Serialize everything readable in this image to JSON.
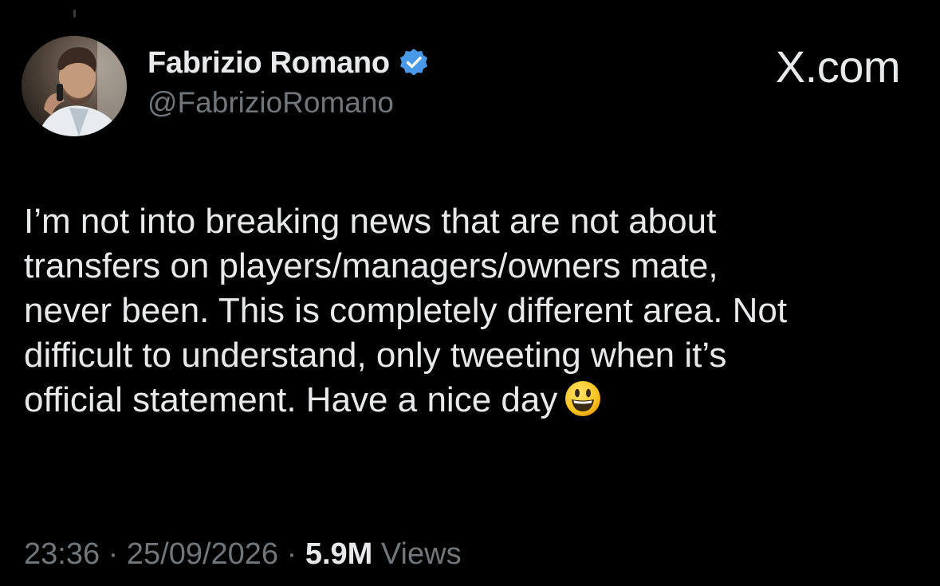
{
  "author": {
    "name": "Fabrizio Romano",
    "handle": "@FabrizioRomano",
    "verified_color": "#4a99e9"
  },
  "brand": {
    "mark": "X.com"
  },
  "tweet": {
    "lines": [
      "I’m not into breaking news that are not about",
      "transfers on players/managers/owners mate,",
      "never been. This is completely different area. Not",
      "difficult to understand, only tweeting when it’s",
      "official statement. Have a nice day"
    ],
    "emoji": "smiling-face-icon"
  },
  "meta": {
    "time": "23:36",
    "separator": "·",
    "date": "25/09/2026",
    "views_count": "5.9M",
    "views_label": "Views"
  },
  "colors": {
    "background": "#000000",
    "text_primary": "#e7e9ea",
    "text_secondary": "#71767b"
  }
}
